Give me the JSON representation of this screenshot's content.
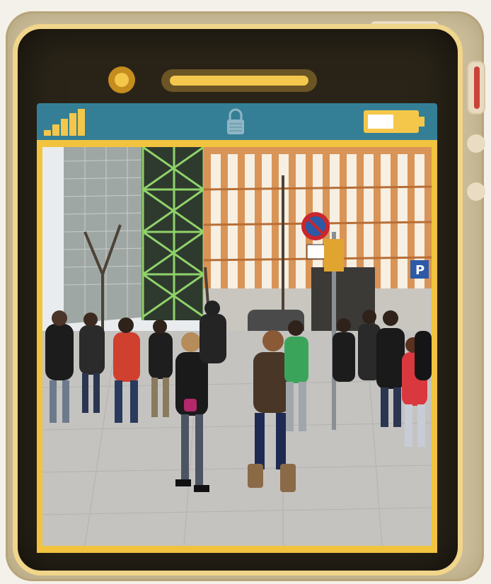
{
  "illustration": {
    "description_items": {
      "phone": "phone-frame",
      "status_icons": [
        "signal-bars-icon",
        "lock-icon",
        "battery-icon"
      ],
      "photo_subject": "street-photo"
    },
    "colors": {
      "case": "#cdbf9c",
      "phone_body": "#2a2418",
      "rim": "#f0d58a",
      "status_bar": "#357f96",
      "accent_yellow": "#f1c33f",
      "side_button_red": "#c8423a"
    },
    "street_sign": {
      "parking_letter": "P"
    }
  }
}
